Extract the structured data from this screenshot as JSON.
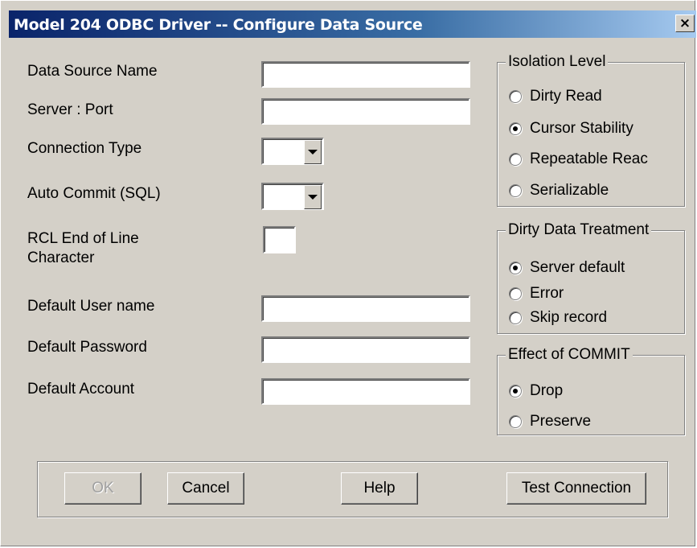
{
  "window": {
    "title": "Model 204 ODBC Driver -- Configure Data Source",
    "close_glyph": "×"
  },
  "fields": {
    "data_source_name": {
      "label": "Data Source Name",
      "value": ""
    },
    "server_port": {
      "label": "Server : Port",
      "value": ""
    },
    "connection_type": {
      "label": "Connection Type",
      "value": ""
    },
    "auto_commit": {
      "label": "Auto Commit (SQL)",
      "value": ""
    },
    "rcl_eol": {
      "label_line1": "RCL End of Line",
      "label_line2": "Character",
      "value": ""
    },
    "default_user": {
      "label": "Default User name",
      "value": ""
    },
    "default_password": {
      "label": "Default Password",
      "value": ""
    },
    "default_account": {
      "label": "Default Account",
      "value": ""
    }
  },
  "isolation_level": {
    "title": "Isolation Level",
    "options": [
      {
        "label": "Dirty Read",
        "selected": false
      },
      {
        "label": "Cursor Stability",
        "selected": true
      },
      {
        "label": "Repeatable Reac",
        "selected": false
      },
      {
        "label": "Serializable",
        "selected": false
      }
    ]
  },
  "dirty_data": {
    "title": "Dirty Data Treatment",
    "options": [
      {
        "label": "Server default",
        "selected": true
      },
      {
        "label": "Error",
        "selected": false
      },
      {
        "label": "Skip record",
        "selected": false
      }
    ]
  },
  "commit_effect": {
    "title": "Effect of COMMIT",
    "options": [
      {
        "label": "Drop",
        "selected": true
      },
      {
        "label": "Preserve",
        "selected": false
      }
    ]
  },
  "buttons": {
    "ok": "OK",
    "cancel": "Cancel",
    "help": "Help",
    "test": "Test Connection"
  },
  "colors": {
    "dialog_bg": "#d4d0c8",
    "title_start": "#0a246a",
    "title_end": "#a6caf0"
  }
}
